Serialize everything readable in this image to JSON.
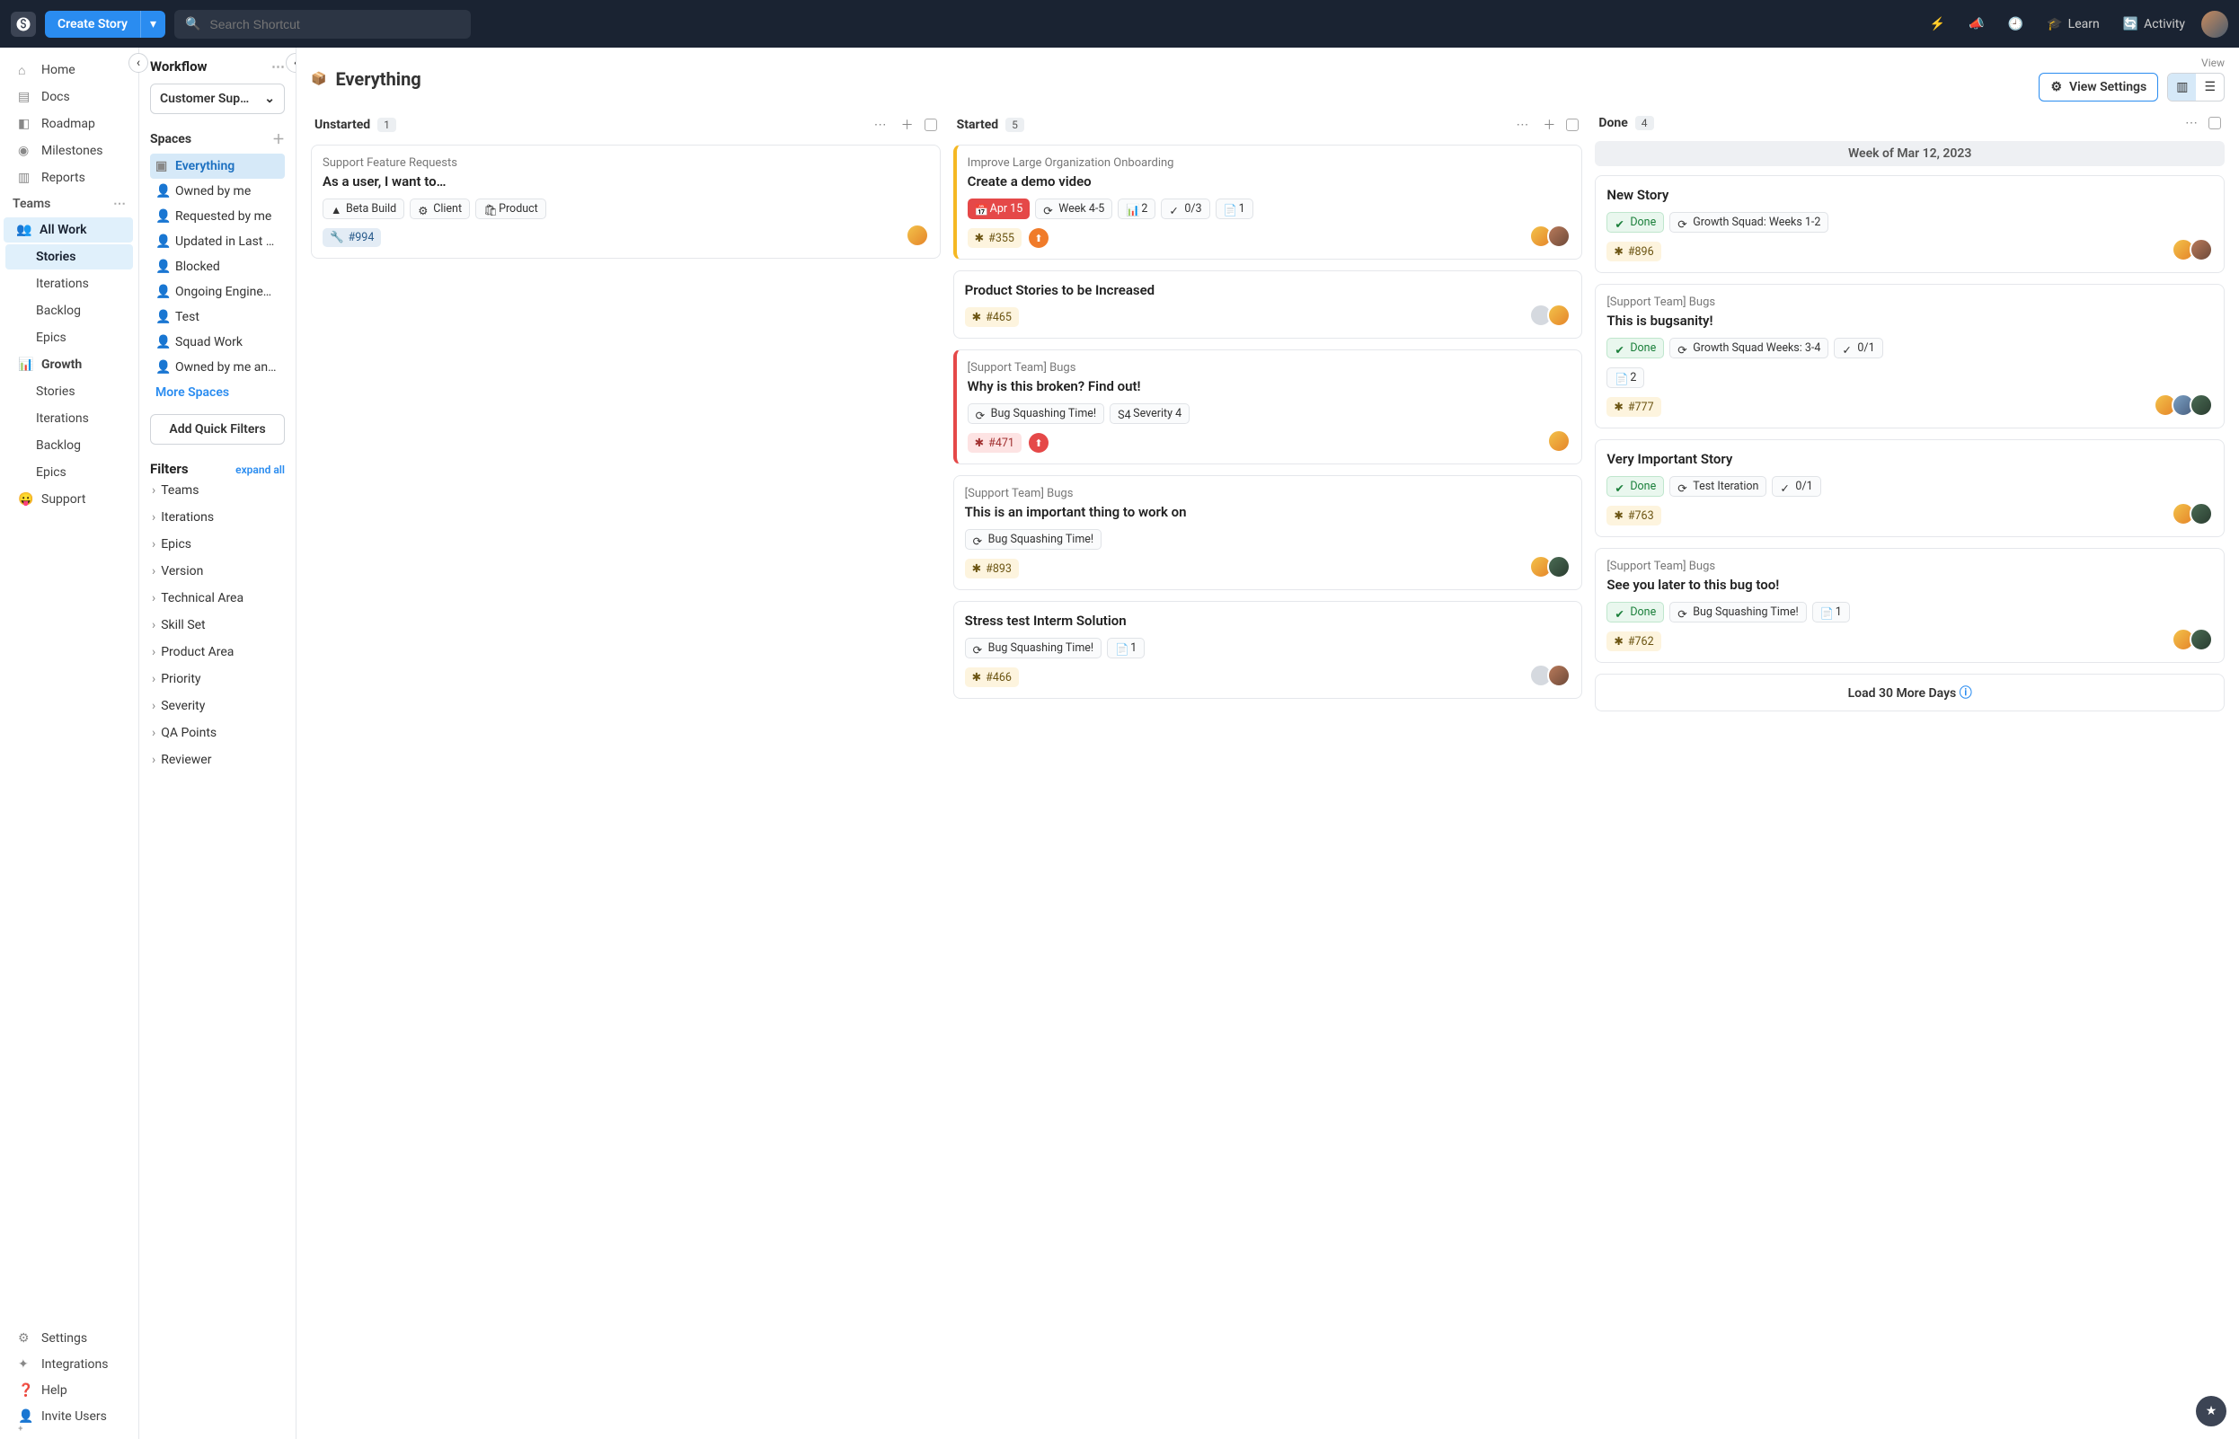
{
  "topbar": {
    "create_label": "Create Story",
    "search_placeholder": "Search Shortcut",
    "learn": "Learn",
    "activity": "Activity"
  },
  "nav": {
    "home": "Home",
    "docs": "Docs",
    "roadmap": "Roadmap",
    "milestones": "Milestones",
    "reports": "Reports",
    "teams_label": "Teams",
    "all_work": "All Work",
    "stories": "Stories",
    "iterations": "Iterations",
    "backlog": "Backlog",
    "epics": "Epics",
    "growth": "Growth",
    "support": "Support",
    "settings": "Settings",
    "integrations": "Integrations",
    "help": "Help",
    "invite": "Invite Users"
  },
  "wf": {
    "title": "Workflow",
    "dropdown": "Customer Sup…",
    "spaces_label": "Spaces",
    "spaces": [
      "Everything",
      "Owned by me",
      "Requested by me",
      "Updated in Last …",
      "Blocked",
      "Ongoing Engine…",
      "Test",
      "Squad Work",
      "Owned by me an…"
    ],
    "more": "More Spaces",
    "quick": "Add Quick Filters",
    "filters_label": "Filters",
    "expand": "expand all",
    "filters": [
      "Teams",
      "Iterations",
      "Epics",
      "Version",
      "Technical Area",
      "Skill Set",
      "Product Area",
      "Priority",
      "Severity",
      "QA Points",
      "Reviewer"
    ]
  },
  "board": {
    "title": "Everything",
    "view_label": "View",
    "view_settings": "View Settings",
    "columns": [
      {
        "name": "Unstarted",
        "count": "1"
      },
      {
        "name": "Started",
        "count": "5"
      },
      {
        "name": "Done",
        "count": "4"
      }
    ],
    "week": "Week of Mar 12, 2023",
    "load_more": "Load 30 More Days",
    "unstarted": [
      {
        "epic": "Support Feature Requests",
        "title": "As a user, I want to…",
        "chips": [
          {
            "t": "Beta Build",
            "c": "orange"
          },
          {
            "t": "Client",
            "c": "pink"
          },
          {
            "t": "Product",
            "c": "purple"
          }
        ],
        "id": "#994",
        "type": "chore",
        "owners": [
          "o1"
        ]
      }
    ],
    "started": [
      {
        "epic": "Improve Large Organization Onboarding",
        "title": "Create a demo video",
        "accent": "yellow",
        "chips": [
          {
            "t": "Apr 15",
            "c": "red-f"
          },
          {
            "t": "Week 4-5",
            "c": "iter"
          },
          {
            "t": "2",
            "c": "stat"
          },
          {
            "t": "0/3",
            "c": "check"
          },
          {
            "t": "1",
            "c": "doc"
          }
        ],
        "id": "#355",
        "prio": "orange",
        "owners": [
          "o1",
          "o2"
        ]
      },
      {
        "title": "Product Stories to be Increased",
        "id": "#465",
        "owners": [
          "team",
          "o1"
        ]
      },
      {
        "epic": "[Support Team] Bugs",
        "title": "Why is this broken? Find out!",
        "accent": "red",
        "chips": [
          {
            "t": "Bug Squashing Time!",
            "c": "iter"
          },
          {
            "t": "Severity 4",
            "c": "sev"
          }
        ],
        "id": "#471",
        "type": "bug",
        "prio": "red",
        "owners": [
          "o1"
        ]
      },
      {
        "epic": "[Support Team] Bugs",
        "title": "This is an important thing to work on",
        "chips": [
          {
            "t": "Bug Squashing Time!",
            "c": "iter"
          }
        ],
        "id": "#893",
        "owners": [
          "o1",
          "o3"
        ]
      },
      {
        "title": "Stress test Interm Solution",
        "chips": [
          {
            "t": "Bug Squashing Time!",
            "c": "iter"
          },
          {
            "t": "1",
            "c": "doc"
          }
        ],
        "id": "#466",
        "owners": [
          "team",
          "o2"
        ]
      }
    ],
    "done": [
      {
        "title": "New Story",
        "chips": [
          {
            "t": "Done",
            "c": "green"
          },
          {
            "t": "Growth Squad: Weeks 1-2",
            "c": "iter"
          }
        ],
        "id": "#896",
        "owners": [
          "o1",
          "o2"
        ]
      },
      {
        "epic": "[Support Team] Bugs",
        "title": "This is bugsanity!",
        "chips": [
          {
            "t": "Done",
            "c": "green"
          },
          {
            "t": "Growth Squad Weeks: 3-4",
            "c": "iter"
          },
          {
            "t": "0/1",
            "c": "check"
          }
        ],
        "extra": [
          {
            "t": "2",
            "c": "doc"
          }
        ],
        "id": "#777",
        "owners": [
          "o1",
          "o4",
          "o3"
        ]
      },
      {
        "title": "Very Important Story",
        "chips": [
          {
            "t": "Done",
            "c": "green"
          },
          {
            "t": "Test Iteration",
            "c": "iter"
          },
          {
            "t": "0/1",
            "c": "check"
          }
        ],
        "id": "#763",
        "owners": [
          "o1",
          "o3"
        ]
      },
      {
        "epic": "[Support Team] Bugs",
        "title": "See you later to this bug too!",
        "chips": [
          {
            "t": "Done",
            "c": "green"
          },
          {
            "t": "Bug Squashing Time!",
            "c": "iter"
          },
          {
            "t": "1",
            "c": "doc"
          }
        ],
        "id": "#762",
        "owners": [
          "o1",
          "o3"
        ]
      }
    ]
  }
}
